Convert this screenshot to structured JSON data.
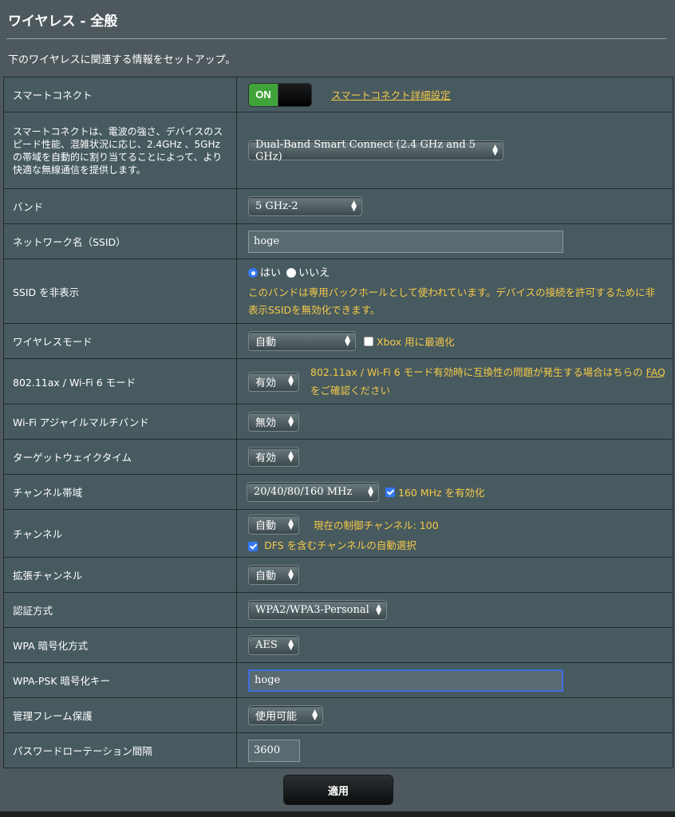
{
  "page": {
    "title": "ワイヤレス - 全般",
    "description": "下のワイヤレスに関連する情報をセットアップ。",
    "apply_label": "適用"
  },
  "colors": {
    "background": "#4d595d",
    "row": "#475a5f",
    "accent_yellow": "#f7c948",
    "toggle_on": "#3fa33a",
    "focus_blue": "#3f6fe0"
  },
  "rows": {
    "smart_connect": {
      "label": "スマートコネクト",
      "toggle": "ON",
      "link": "スマートコネクト詳細設定"
    },
    "smart_connect_desc": {
      "label": "スマートコネクトは、電波の強さ、デバイスのスピード性能、混雑状況に応じ、2.4GHz 、5GHz の帯域を自動的に割り当てることによって、より快適な無線通信を提供します。",
      "selected": "Dual-Band Smart Connect (2.4 GHz and 5 GHz)"
    },
    "band": {
      "label": "バンド",
      "selected": "5 GHz-2"
    },
    "ssid": {
      "label": "ネットワーク名（SSID）",
      "value": "hoge"
    },
    "hide_ssid": {
      "label": "SSID を非表示",
      "yes": "はい",
      "no": "いいえ",
      "note": "このバンドは専用バックホールとして使われています。デバイスの接続を許可するために非表示SSIDを無効化できます。"
    },
    "wireless_mode": {
      "label": "ワイヤレスモード",
      "selected": "自動",
      "xbox_label": "Xbox 用に最適化"
    },
    "wifi6": {
      "label": "802.11ax / Wi-Fi 6 モード",
      "selected": "有効",
      "note_pre": "802.11ax / Wi-Fi 6 モード有効時に互換性の問題が発生する場合はちらの",
      "faq": "FAQ",
      "note_post": "をご確認ください"
    },
    "agile_multiband": {
      "label": "Wi-Fi アジャイルマルチバンド",
      "selected": "無効"
    },
    "twt": {
      "label": "ターゲットウェイクタイム",
      "selected": "有効"
    },
    "bandwidth": {
      "label": "チャンネル帯域",
      "selected": "20/40/80/160 MHz",
      "check_label": "160 MHz を有効化"
    },
    "channel": {
      "label": "チャンネル",
      "selected": "自動",
      "current": "現在の制御チャンネル: 100",
      "dfs_label": "DFS を含むチャンネルの自動選択"
    },
    "ext_channel": {
      "label": "拡張チャンネル",
      "selected": "自動"
    },
    "auth": {
      "label": "認証方式",
      "selected": "WPA2/WPA3-Personal"
    },
    "wpa_enc": {
      "label": "WPA 暗号化方式",
      "selected": "AES"
    },
    "psk": {
      "label": "WPA-PSK 暗号化キー",
      "value": "hoge"
    },
    "pmf": {
      "label": "管理フレーム保護",
      "selected": "使用可能"
    },
    "rotation": {
      "label": "パスワードローテーション間隔",
      "value": "3600"
    }
  }
}
